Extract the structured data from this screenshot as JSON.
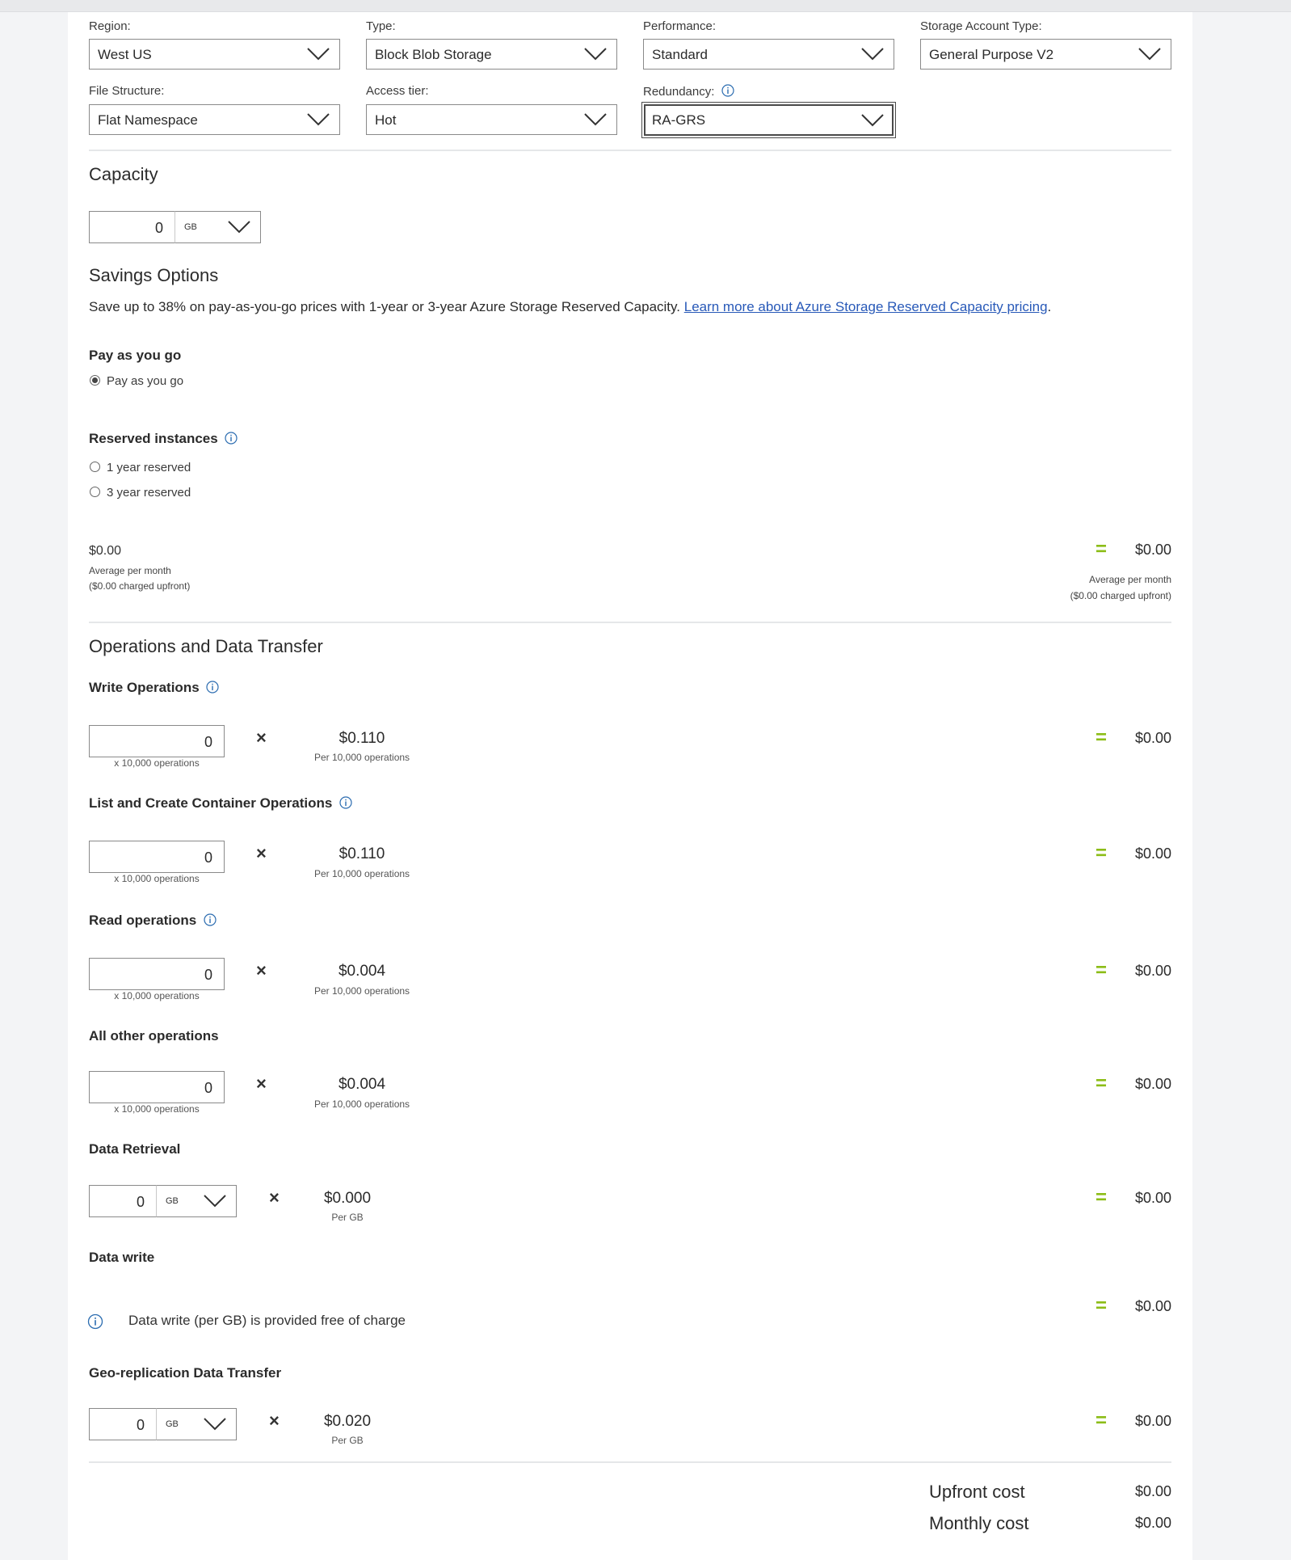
{
  "filters": {
    "region": {
      "label": "Region:",
      "value": "West US"
    },
    "type": {
      "label": "Type:",
      "value": "Block Blob Storage"
    },
    "performance": {
      "label": "Performance:",
      "value": "Standard"
    },
    "account_type": {
      "label": "Storage Account Type:",
      "value": "General Purpose V2"
    },
    "file_structure": {
      "label": "File Structure:",
      "value": "Flat Namespace"
    },
    "access_tier": {
      "label": "Access tier:",
      "value": "Hot"
    },
    "redundancy": {
      "label": "Redundancy:",
      "value": "RA-GRS"
    }
  },
  "capacity": {
    "title": "Capacity",
    "value": "0",
    "unit": "GB"
  },
  "savings": {
    "title": "Savings Options",
    "description": "Save up to 38% on pay-as-you-go prices with 1-year or 3-year Azure Storage Reserved Capacity.",
    "link_text": "Learn more about Azure Storage Reserved Capacity pricing",
    "period": ".",
    "payg_title": "Pay as you go",
    "payg_option": "Pay as you go",
    "reserved_title": "Reserved instances",
    "reserved_1": "1 year reserved",
    "reserved_3": "3 year reserved",
    "left_price": "$0.00",
    "left_avg": "Average per month",
    "left_upfront": "($0.00 charged upfront)",
    "right_price": "$0.00",
    "right_avg": "Average per month",
    "right_upfront": "($0.00 charged upfront)"
  },
  "operations": {
    "title": "Operations and Data Transfer",
    "write": {
      "title": "Write Operations",
      "value": "0",
      "unit": "x 10,000 operations",
      "price": "$0.110",
      "per": "Per 10,000 operations",
      "total": "$0.00"
    },
    "list_create": {
      "title": "List and Create Container Operations",
      "value": "0",
      "unit": "x 10,000 operations",
      "price": "$0.110",
      "per": "Per 10,000 operations",
      "total": "$0.00"
    },
    "read": {
      "title": "Read operations",
      "value": "0",
      "unit": "x 10,000 operations",
      "price": "$0.004",
      "per": "Per 10,000 operations",
      "total": "$0.00"
    },
    "other": {
      "title": "All other operations",
      "value": "0",
      "unit": "x 10,000 operations",
      "price": "$0.004",
      "per": "Per 10,000 operations",
      "total": "$0.00"
    },
    "retrieval": {
      "title": "Data Retrieval",
      "value": "0",
      "unit": "GB",
      "price": "$0.000",
      "per": "Per GB",
      "total": "$0.00"
    },
    "data_write": {
      "title": "Data write",
      "note": "Data write (per GB) is provided free of charge",
      "total": "$0.00"
    },
    "geo": {
      "title": "Geo-replication Data Transfer",
      "value": "0",
      "unit": "GB",
      "price": "$0.020",
      "per": "Per GB",
      "total": "$0.00"
    }
  },
  "symbols": {
    "times": "×",
    "equals": "="
  },
  "summary": {
    "upfront_label": "Upfront cost",
    "upfront_value": "$0.00",
    "monthly_label": "Monthly cost",
    "monthly_value": "$0.00"
  },
  "colors": {
    "accent_green": "#8cbd18",
    "link_blue": "#2859b8",
    "info_blue": "#2b6cb0"
  }
}
